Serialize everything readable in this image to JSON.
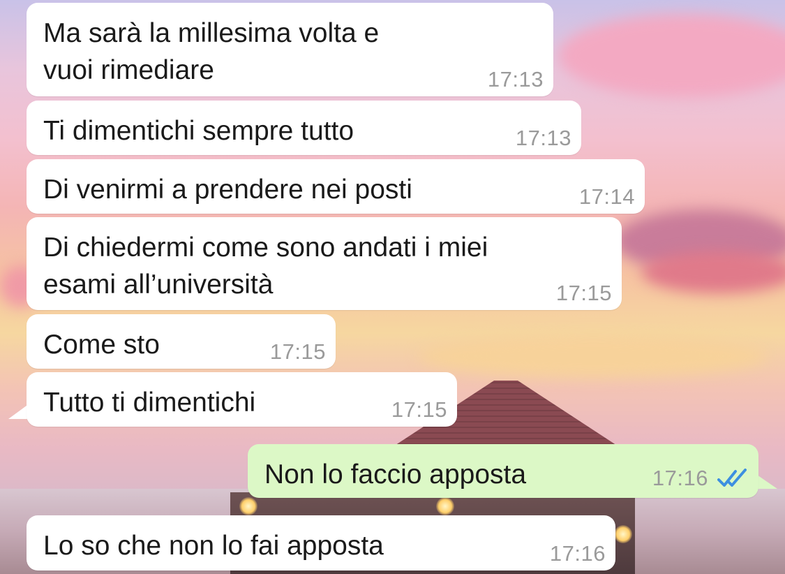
{
  "chat": {
    "messages": [
      {
        "direction": "in",
        "text": "Ma sarà la millesima volta e\nvuoi rimediare",
        "time": "17:13"
      },
      {
        "direction": "in",
        "text": "Ti dimentichi sempre tutto",
        "time": "17:13"
      },
      {
        "direction": "in",
        "text": "Di venirmi a prendere nei posti",
        "time": "17:14"
      },
      {
        "direction": "in",
        "text": "Di chiedermi come sono andati i miei\nesami all’università",
        "time": "17:15"
      },
      {
        "direction": "in",
        "text": "Come sto",
        "time": "17:15"
      },
      {
        "direction": "in",
        "text": "Tutto ti dimentichi",
        "time": "17:15"
      },
      {
        "direction": "out",
        "text": "Non lo faccio apposta",
        "time": "17:16",
        "status": "read",
        "status_icon": "double-check-icon",
        "status_color": "#3d8fe0"
      },
      {
        "direction": "in",
        "text": "Lo so che non lo fai apposta",
        "time": "17:16"
      }
    ]
  },
  "colors": {
    "incoming_bubble": "#ffffff",
    "outgoing_bubble": "#dcf8c6",
    "timestamp": "#9a9a9a"
  }
}
